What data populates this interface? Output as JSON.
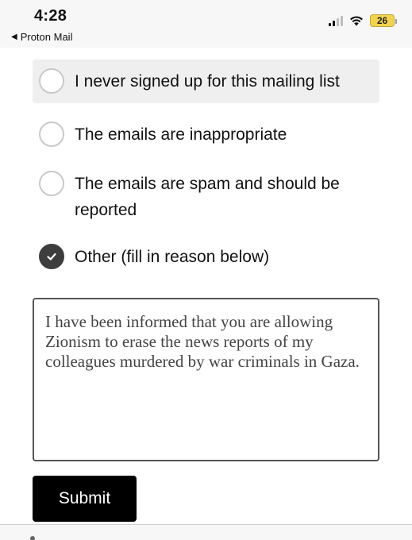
{
  "status_bar": {
    "time": "4:28",
    "back_app": "Proton Mail",
    "battery": "26"
  },
  "form": {
    "options": [
      {
        "label": "I never signed up for this mailing list",
        "checked": false
      },
      {
        "label": "The emails are inappropriate",
        "checked": false
      },
      {
        "label": "The emails are spam and should be reported",
        "checked": false
      },
      {
        "label": "Other (fill in reason below)",
        "checked": true
      }
    ],
    "reason_text": "I have been informed that you are allowing Zionism to erase the news reports of my colleagues murdered by war criminals in Gaza.",
    "submit_label": "Submit"
  },
  "colors": {
    "checked_radio": "#3d3d3d",
    "submit_bg": "#000000",
    "battery": "#f5d44d"
  }
}
